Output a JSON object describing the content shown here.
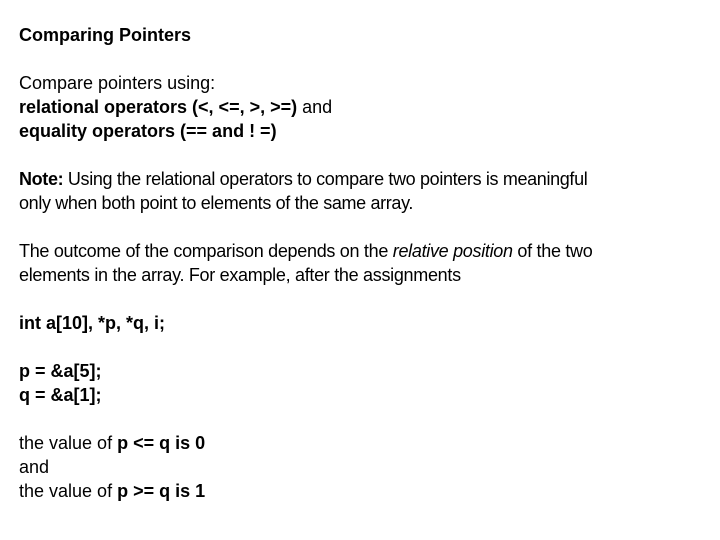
{
  "slide": {
    "title": "Comparing Pointers",
    "intro": {
      "line1": "Compare pointers using:",
      "relational_label": "relational operators (<, <=, >, >=)",
      "relational_suffix": " and",
      "equality_label": "equality operators (== and ! =)"
    },
    "note": {
      "label": "Note:",
      "line1_text": " Using the relational operators to compare two pointers is meaningful",
      "line2_text": "only when both point to elements of the same array."
    },
    "outcome": {
      "line1_prefix": "The outcome of the comparison depends on the ",
      "line1_emphasis": "relative position",
      "line1_suffix": " of the two",
      "line2": "elements in the array. For example, after the assignments"
    },
    "code": {
      "declaration": "int a[10], *p, *q, i;",
      "assign_p": "p = &a[5];",
      "assign_q": "q = &a[1];"
    },
    "results": {
      "r1_prefix": "the value of ",
      "r1_expr": "p <= q is 0",
      "connector": "and",
      "r2_prefix": "the value of ",
      "r2_expr": "p >= q is 1"
    }
  }
}
